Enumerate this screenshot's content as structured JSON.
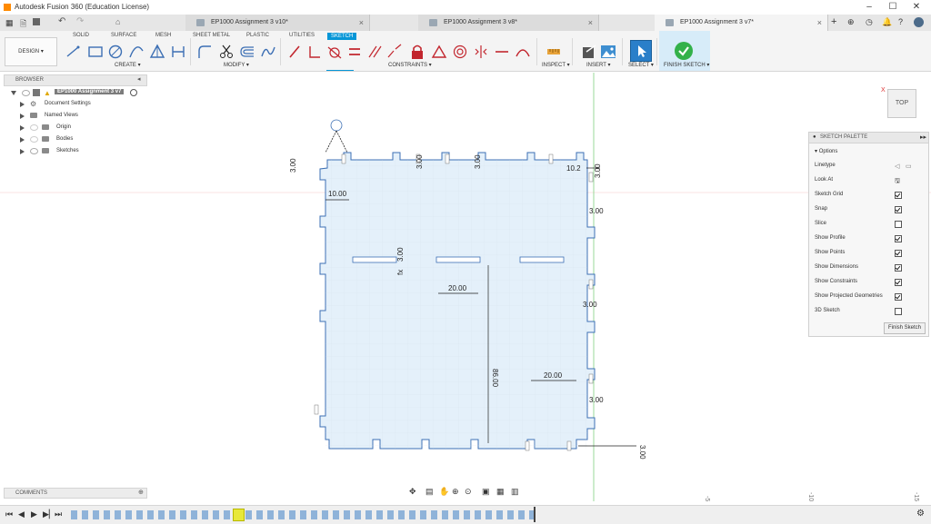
{
  "window": {
    "title": "Autodesk Fusion 360 (Education License)"
  },
  "tabs": [
    {
      "label": "EP1000 Assignment 3 v10*",
      "active": false
    },
    {
      "label": "EP1000 Assignment 3 v8*",
      "active": false
    },
    {
      "label": "EP1000 Assignment 3 v7*",
      "active": true
    }
  ],
  "toolbar": {
    "workspace": "DESIGN",
    "workspace_tabs": [
      "SOLID",
      "SURFACE",
      "MESH",
      "SHEET METAL",
      "PLASTIC",
      "UTILITIES",
      "SKETCH"
    ],
    "groups": {
      "create": "CREATE",
      "modify": "MODIFY",
      "constraints": "CONSTRAINTS",
      "inspect": "INSPECT",
      "insert": "INSERT",
      "select": "SELECT",
      "finish": "FINISH SKETCH"
    }
  },
  "browser": {
    "title": "BROWSER",
    "root": "EP1000 Assignment 3 v7",
    "items": [
      "Document Settings",
      "Named Views",
      "Origin",
      "Bodies",
      "Sketches"
    ]
  },
  "comments": {
    "title": "COMMENTS"
  },
  "palette": {
    "title": "SKETCH PALETTE",
    "section": "Options",
    "rows": [
      {
        "label": "Linetype",
        "kind": "icons"
      },
      {
        "label": "Look At",
        "kind": "icon"
      },
      {
        "label": "Sketch Grid",
        "kind": "check",
        "checked": true
      },
      {
        "label": "Snap",
        "kind": "check",
        "checked": true
      },
      {
        "label": "Slice",
        "kind": "check",
        "checked": false
      },
      {
        "label": "Show Profile",
        "kind": "check",
        "checked": true
      },
      {
        "label": "Show Points",
        "kind": "check",
        "checked": true
      },
      {
        "label": "Show Dimensions",
        "kind": "check",
        "checked": true
      },
      {
        "label": "Show Constraints",
        "kind": "check",
        "checked": true
      },
      {
        "label": "Show Projected Geometries",
        "kind": "check",
        "checked": true
      },
      {
        "label": "3D Sketch",
        "kind": "check",
        "checked": false
      }
    ],
    "finish_button": "Finish Sketch"
  },
  "viewcube": {
    "face": "TOP",
    "axis": "X"
  },
  "dimensions": {
    "d1": "10.00",
    "d2": "3.00",
    "d3": "20.00",
    "d4": "86.00",
    "d5": "20.00",
    "d6": "10.2",
    "fx": "fx",
    "d7": "3.00",
    "d8": "3.00",
    "d9": "3.00",
    "d10": "3.00",
    "d11": "3.00",
    "d12": "3.00",
    "d13": "3.00",
    "d14": "3.00"
  },
  "ruler": [
    "-5",
    "-10",
    "-15"
  ],
  "colors": {
    "accent": "#0696d7",
    "sketch_fill": "#e6f2fb",
    "sketch_line": "#3c6fb4",
    "finish_green": "#33b14a"
  }
}
